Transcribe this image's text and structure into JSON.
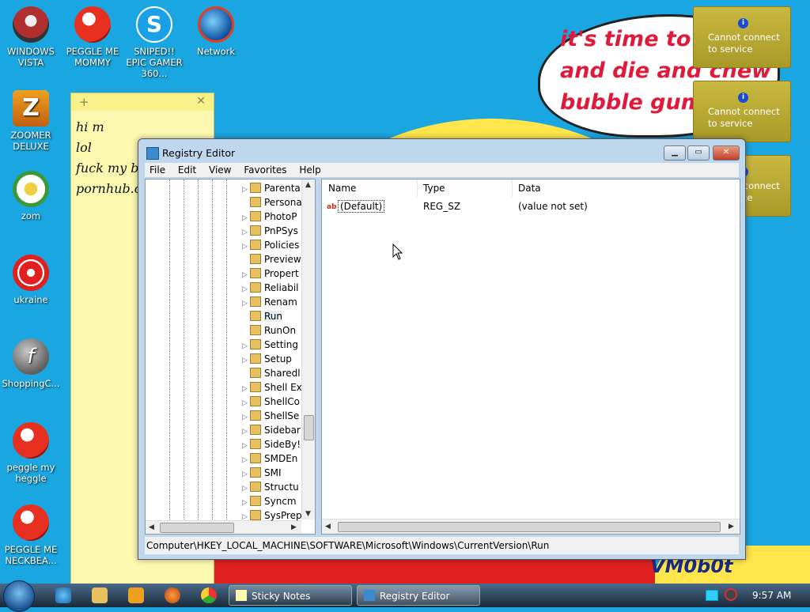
{
  "wallpaper": {
    "cloud_text": "it's time to e\nand die and chew\nbubble gum",
    "signature": "VM0b0t"
  },
  "desktop_icons": [
    {
      "label": "WINDOWS VISTA"
    },
    {
      "label": "PEGGLE ME MOMMY"
    },
    {
      "label": "SNIPED!! EPIC GAMER 360..."
    },
    {
      "label": "Network"
    },
    {
      "label": "ZOOMER DELUXE"
    },
    {
      "label": "zom"
    },
    {
      "label": "ukraine"
    },
    {
      "label": "ShoppingC..."
    },
    {
      "label": "peggle my heggle"
    },
    {
      "label": "PEGGLE ME NECKBEA..."
    }
  ],
  "sticky_note": {
    "add": "+",
    "close": "✕",
    "lines": [
      "hi m",
      "lol",
      "fuck my b",
      "pornhub.c"
    ]
  },
  "notifications": [
    {
      "text": "Cannot connect to service"
    },
    {
      "text": "Cannot connect to service"
    },
    {
      "text": "Cannot connect to service"
    }
  ],
  "regedit": {
    "title": "Registry Editor",
    "menu": [
      "File",
      "Edit",
      "View",
      "Favorites",
      "Help"
    ],
    "tree_items": [
      {
        "label": "Parenta",
        "expandable": true
      },
      {
        "label": "Persona",
        "expandable": false
      },
      {
        "label": "PhotoP",
        "expandable": true
      },
      {
        "label": "PnPSys",
        "expandable": true
      },
      {
        "label": "Policies",
        "expandable": true
      },
      {
        "label": "Preview",
        "expandable": false
      },
      {
        "label": "Propert",
        "expandable": true
      },
      {
        "label": "Reliabil",
        "expandable": true
      },
      {
        "label": "Renam",
        "expandable": true
      },
      {
        "label": "Run",
        "expandable": false,
        "selected": true
      },
      {
        "label": "RunOn",
        "expandable": false
      },
      {
        "label": "Setting",
        "expandable": true
      },
      {
        "label": "Setup",
        "expandable": true
      },
      {
        "label": "Sharedl",
        "expandable": false
      },
      {
        "label": "Shell Ex",
        "expandable": true
      },
      {
        "label": "ShellCo",
        "expandable": true
      },
      {
        "label": "ShellSe",
        "expandable": true
      },
      {
        "label": "Sidebar",
        "expandable": true
      },
      {
        "label": "SideBy!",
        "expandable": true
      },
      {
        "label": "SMDEn",
        "expandable": true
      },
      {
        "label": "SMI",
        "expandable": true
      },
      {
        "label": "Structu",
        "expandable": true
      },
      {
        "label": "Syncm",
        "expandable": true
      },
      {
        "label": "SysPrep",
        "expandable": true
      }
    ],
    "columns": {
      "name": "Name",
      "type": "Type",
      "data": "Data"
    },
    "values": [
      {
        "icon": "ab",
        "name": "(Default)",
        "type": "REG_SZ",
        "data": "(value not set)"
      }
    ],
    "status_path": "Computer\\HKEY_LOCAL_MACHINE\\SOFTWARE\\Microsoft\\Windows\\CurrentVersion\\Run"
  },
  "taskbar": {
    "buttons": [
      {
        "label": "Sticky Notes"
      },
      {
        "label": "Registry Editor"
      }
    ],
    "clock": "9:57 AM"
  }
}
